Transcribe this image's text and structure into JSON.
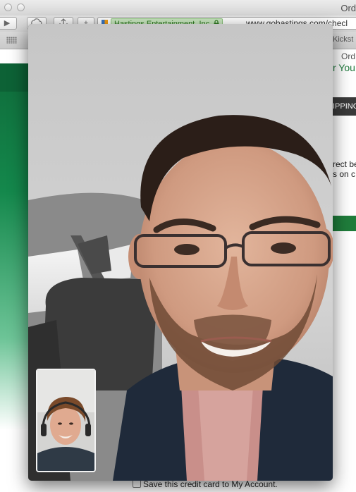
{
  "browser": {
    "window_title": "Ord",
    "toolbar": {
      "back_label": "◀",
      "forward_label": "▶",
      "add_label": "+",
      "ev_badge": "Hastings Entertainment, Inc.",
      "url": "www.gohastings.com/checl"
    },
    "bookmarks": {
      "item_1": "Kickst",
      "item_2": "Ord"
    },
    "page": {
      "heading_fragment": "r You",
      "tab_fragment": "IPPING",
      "text_line_1": "rect be",
      "text_line_2": "s on c",
      "save_card_label": "Save this credit card to My Account."
    }
  },
  "facetime": {
    "remote_video": "remote-caller-video",
    "local_preview": "self-preview-video"
  },
  "colors": {
    "brand_green": "#1f7d3b",
    "ev_green_bg": "#c9e7c0"
  }
}
